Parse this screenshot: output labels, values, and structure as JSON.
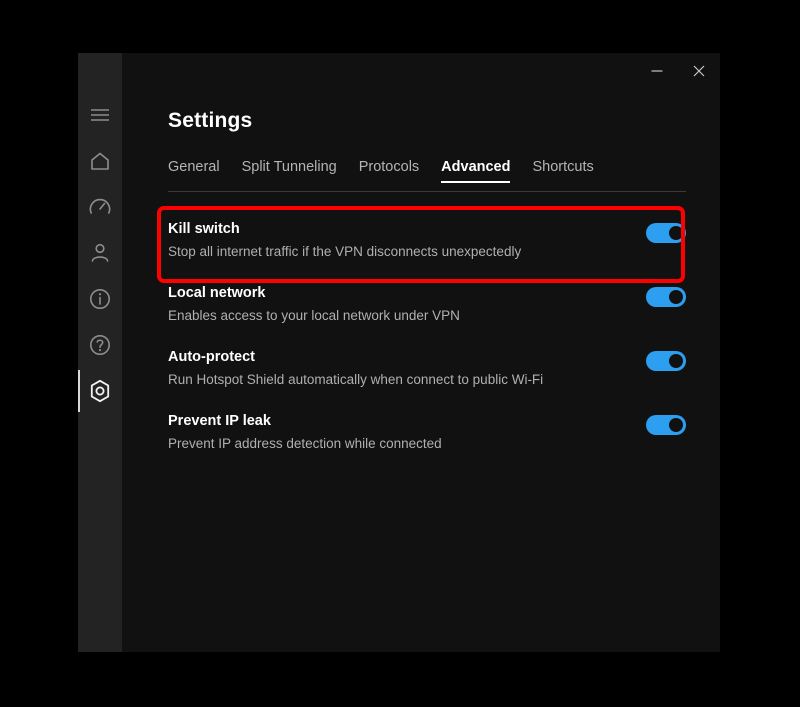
{
  "window": {
    "controls": [
      {
        "name": "minimize",
        "glyph": "minimize-icon"
      },
      {
        "name": "close",
        "glyph": "close-icon"
      }
    ]
  },
  "sidebar": {
    "items": [
      {
        "icon": "hamburger-menu-icon",
        "label": "Menu",
        "active": false
      },
      {
        "icon": "home-icon",
        "label": "Home",
        "active": false
      },
      {
        "icon": "speedometer-icon",
        "label": "Speed test",
        "active": false
      },
      {
        "icon": "person-icon",
        "label": "Account",
        "active": false
      },
      {
        "icon": "info-icon",
        "label": "About",
        "active": false
      },
      {
        "icon": "help-icon",
        "label": "Help",
        "active": false
      },
      {
        "icon": "settings-gear-icon",
        "label": "Settings",
        "active": true
      }
    ]
  },
  "header": {
    "title": "Settings"
  },
  "tabs": [
    {
      "label": "General",
      "active": false
    },
    {
      "label": "Split Tunneling",
      "active": false
    },
    {
      "label": "Protocols",
      "active": false
    },
    {
      "label": "Advanced",
      "active": true
    },
    {
      "label": "Shortcuts",
      "active": false
    }
  ],
  "settings": [
    {
      "title": "Kill switch",
      "description": "Stop all internet traffic if the VPN disconnects unexpectedly",
      "toggle_state": "on",
      "highlighted": true
    },
    {
      "title": "Local network",
      "description": "Enables access to your local network under VPN",
      "toggle_state": "on",
      "highlighted": false
    },
    {
      "title": "Auto-protect",
      "description": "Run Hotspot Shield automatically when connect to public Wi-Fi",
      "toggle_state": "on",
      "highlighted": false
    },
    {
      "title": "Prevent IP leak",
      "description": "Prevent IP address detection while connected",
      "toggle_state": "on",
      "highlighted": false
    }
  ],
  "colors": {
    "accent_toggle_on": "#2c9ff0",
    "annotation": "#ff0000",
    "window_background": "#111111",
    "sidebar_background": "#232323"
  }
}
